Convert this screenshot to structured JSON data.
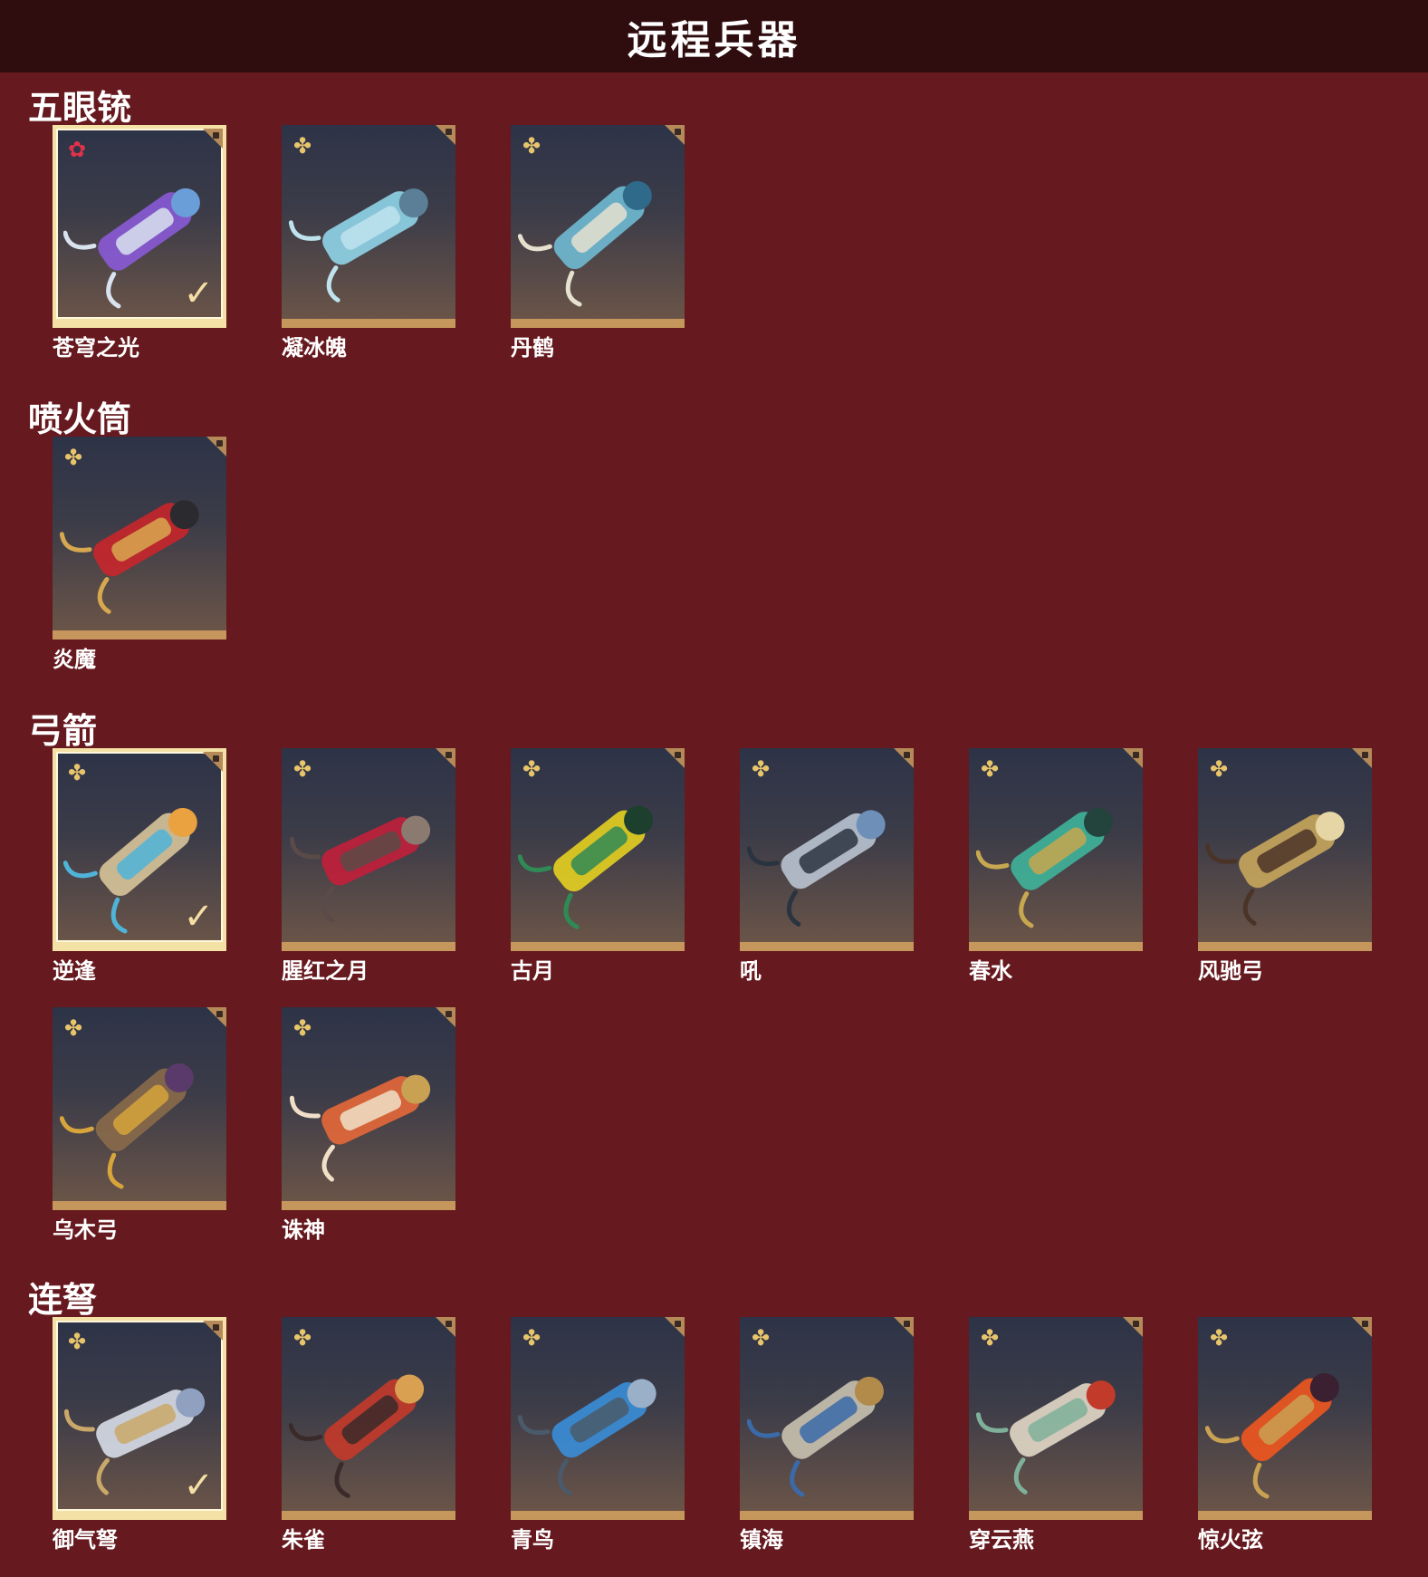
{
  "header": {
    "title": "远程兵器"
  },
  "sections": [
    {
      "title": "五眼铳",
      "items": [
        {
          "name": "苍穹之光",
          "badge": "red-star-icon",
          "selected": true,
          "colors": [
            "#8a5ad6",
            "#d9e2ef",
            "#6a9ed8"
          ]
        },
        {
          "name": "凝冰魄",
          "badge": "gold-star-icon",
          "selected": false,
          "colors": [
            "#8fd4e8",
            "#bfe3ee",
            "#5a7f96"
          ]
        },
        {
          "name": "丹鹤",
          "badge": "gold-star-icon",
          "selected": false,
          "colors": [
            "#6fbad3",
            "#e6e1cf",
            "#2f6a8a"
          ]
        }
      ]
    },
    {
      "title": "喷火筒",
      "items": [
        {
          "name": "炎魔",
          "badge": "gold-star-icon",
          "selected": false,
          "colors": [
            "#c8262b",
            "#d8a850",
            "#2b2b2f"
          ]
        }
      ]
    },
    {
      "title": "弓箭",
      "items": [
        {
          "name": "逆逢",
          "badge": "gold-star-icon",
          "selected": true,
          "colors": [
            "#d7c49a",
            "#4fb4d8",
            "#e9a23f"
          ]
        },
        {
          "name": "腥红之月",
          "badge": "gold-star-icon",
          "selected": false,
          "colors": [
            "#c21f3a",
            "#5a4a48",
            "#8a7a70"
          ]
        },
        {
          "name": "古月",
          "badge": "gold-star-icon",
          "selected": false,
          "colors": [
            "#e4d021",
            "#2f8a55",
            "#1c3f2e"
          ]
        },
        {
          "name": "吼",
          "badge": "gold-star-icon",
          "selected": false,
          "colors": [
            "#b9c3d0",
            "#2a3440",
            "#6e90b8"
          ]
        },
        {
          "name": "春水",
          "badge": "gold-star-icon",
          "selected": false,
          "colors": [
            "#3fb49a",
            "#c7a74f",
            "#23443c"
          ]
        },
        {
          "name": "风驰弓",
          "badge": "gold-star-icon",
          "selected": false,
          "colors": [
            "#c8a65c",
            "#4a3428",
            "#e6d6a6"
          ]
        },
        {
          "name": "乌木弓",
          "badge": "gold-star-icon",
          "selected": false,
          "colors": [
            "#8a6a4a",
            "#d7a53a",
            "#5a3a6a"
          ]
        },
        {
          "name": "诛神",
          "badge": "gold-star-icon",
          "selected": false,
          "colors": [
            "#e6683a",
            "#f0e0c8",
            "#c9a152"
          ]
        }
      ]
    },
    {
      "title": "连弩",
      "items": [
        {
          "name": "御气弩",
          "badge": "gold-star-icon",
          "selected": true,
          "colors": [
            "#d7dde8",
            "#c9a86a",
            "#8fa0c0"
          ]
        },
        {
          "name": "朱雀",
          "badge": "gold-star-icon",
          "selected": false,
          "colors": [
            "#c43a2a",
            "#3a2a2a",
            "#d8a050"
          ]
        },
        {
          "name": "青鸟",
          "badge": "gold-star-icon",
          "selected": false,
          "colors": [
            "#3a8ed8",
            "#4a5a6a",
            "#9ab0c8"
          ]
        },
        {
          "name": "镇海",
          "badge": "gold-star-icon",
          "selected": false,
          "colors": [
            "#c9c2b0",
            "#3a6aa8",
            "#b28a4a"
          ]
        },
        {
          "name": "穿云燕",
          "badge": "gold-star-icon",
          "selected": false,
          "colors": [
            "#e2d8c6",
            "#7fb09a",
            "#c23a2a"
          ]
        },
        {
          "name": "惊火弦",
          "badge": "gold-star-icon",
          "selected": false,
          "colors": [
            "#f0561e",
            "#c9a152",
            "#3a2030"
          ]
        }
      ]
    }
  ],
  "colors": {
    "background": "#66191e",
    "header_bg": "#2f0c0e",
    "tile_border": "#c5975d",
    "selected_border": "#f4e1a6"
  }
}
